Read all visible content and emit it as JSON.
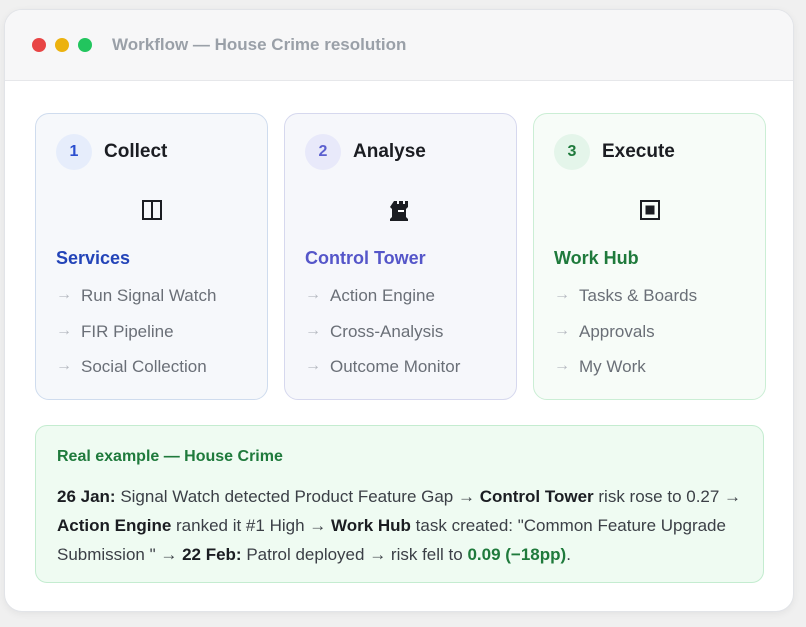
{
  "window": {
    "title": "Workflow — House Crime resolution"
  },
  "cards": [
    {
      "number": "1",
      "title": "Collect",
      "icon": "split-panel-icon",
      "subtitle": "Services",
      "items": [
        "Run Signal Watch",
        "FIR Pipeline",
        "Social Collection"
      ]
    },
    {
      "number": "2",
      "title": "Analyse",
      "icon": "tower-icon",
      "subtitle": "Control Tower",
      "items": [
        "Action Engine",
        "Cross-Analysis",
        "Outcome Monitor"
      ]
    },
    {
      "number": "3",
      "title": "Execute",
      "icon": "square-stop-icon",
      "subtitle": "Work Hub",
      "items": [
        "Tasks & Boards",
        "Approvals",
        "My Work"
      ]
    }
  ],
  "arrow_glyph": "→",
  "example": {
    "title": "Real example — House Crime",
    "date1": "26 Jan:",
    "text1": " Signal Watch detected Product Feature Gap → ",
    "tower": "Control Tower",
    "text2": " risk rose to 0.27 → ",
    "engine": "Action Engine",
    "text3": " ranked it #1 High → ",
    "hub": "Work Hub",
    "text4": " task created: \"Common Feature Upgrade Submission \" → ",
    "date2": "22 Feb:",
    "text5": " Patrol deployed → risk fell to ",
    "result": "0.09 (−18pp)",
    "text6": "."
  },
  "colors": {
    "dot_red": "#e84545",
    "dot_yellow": "#ecb20f",
    "dot_green": "#22c55e",
    "collect_accent": "#2344b8",
    "analyse_accent": "#5556c9",
    "execute_accent": "#1f7a3c"
  }
}
